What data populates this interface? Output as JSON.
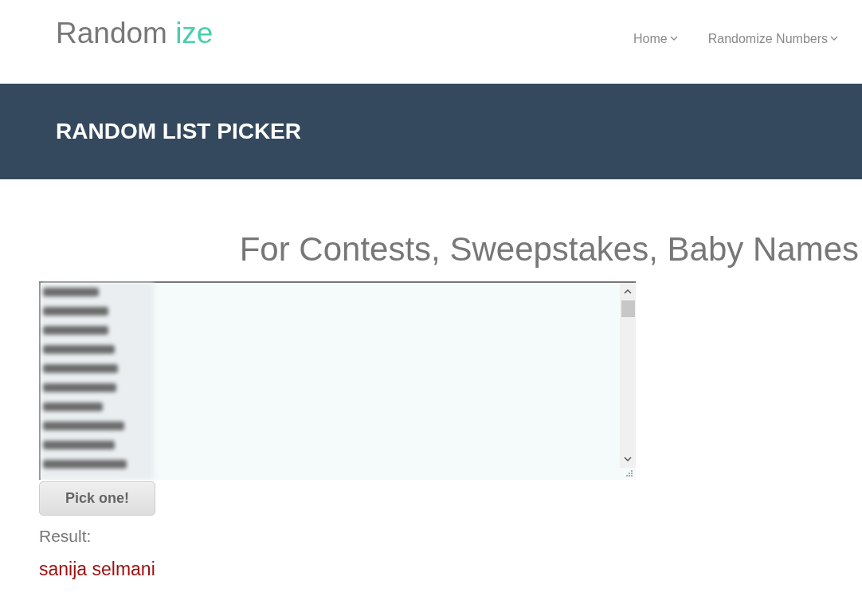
{
  "logo": {
    "text": "Random",
    "accent": "ize"
  },
  "nav": [
    {
      "label": "Home"
    },
    {
      "label": "Randomize Numbers"
    }
  ],
  "banner": {
    "title": "RANDOM LIST PICKER"
  },
  "heading": "For Contests, Sweepstakes, Baby Names",
  "pick_button": "Pick one!",
  "result_label": "Result:",
  "result_value": "sanija selmani"
}
